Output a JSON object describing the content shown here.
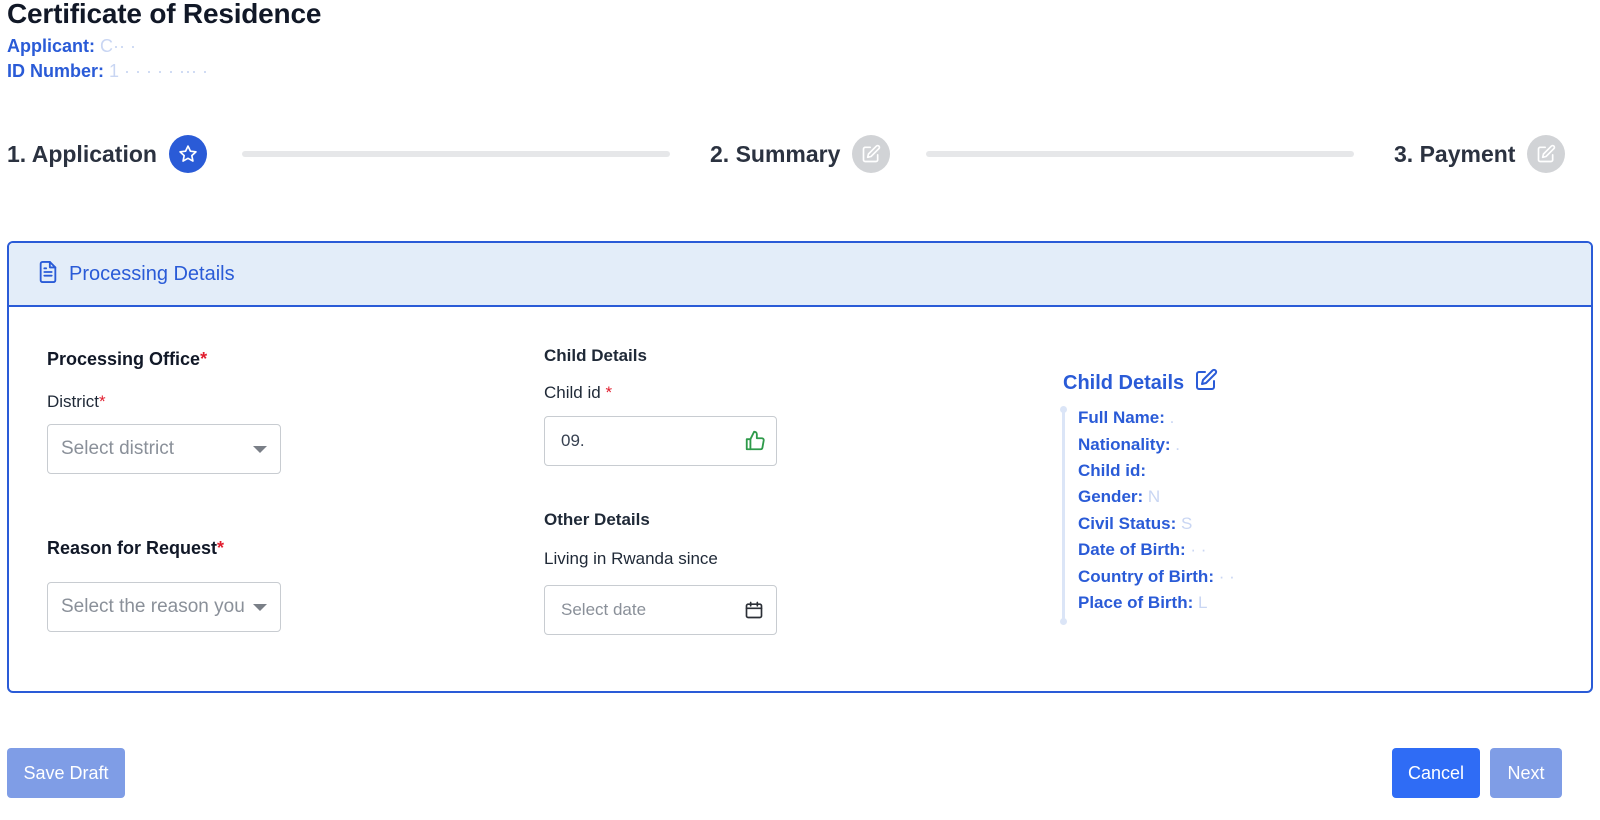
{
  "header": {
    "title": "Certificate of Residence",
    "applicant_label": "Applicant:",
    "applicant_value": "C·· ·",
    "id_label": "ID Number:",
    "id_value": "1 ·  ·  ·  ·  · ··· ·"
  },
  "stepper": {
    "steps": [
      {
        "label": "1. Application",
        "state": "active",
        "icon": "star-icon"
      },
      {
        "label": "2. Summary",
        "state": "inactive",
        "icon": "edit-icon"
      },
      {
        "label": "3. Payment",
        "state": "inactive",
        "icon": "edit-icon"
      }
    ]
  },
  "card": {
    "title": "Processing Details",
    "icon": "document-icon"
  },
  "processing_office": {
    "title": "Processing Office",
    "required_mark": "*",
    "district_label": "District",
    "district_placeholder": "Select district",
    "reason_title": "Reason for Request",
    "reason_placeholder": "Select the reason you"
  },
  "child_form": {
    "title": "Child Details",
    "child_id_label": "Child id",
    "child_id_value": "09.",
    "child_id_status_icon": "thumbs-up-icon",
    "other_title": "Other Details",
    "living_since_label": "Living in Rwanda since",
    "date_placeholder": "Select date"
  },
  "child_details_panel": {
    "title": "Child Details",
    "rows": [
      {
        "label": "Full Name:",
        "value": " ."
      },
      {
        "label": "Nationality:",
        "value": " ."
      },
      {
        "label": "Child id:",
        "value": ""
      },
      {
        "label": "Gender:",
        "value": " N"
      },
      {
        "label": "Civil Status:",
        "value": " S"
      },
      {
        "label": "Date of Birth:",
        "value": " · ·"
      },
      {
        "label": "Country of Birth:",
        "value": " · ·"
      },
      {
        "label": "Place of Birth:",
        "value": " L"
      }
    ]
  },
  "buttons": {
    "save_draft": "Save Draft",
    "cancel": "Cancel",
    "next": "Next"
  },
  "colors": {
    "accent": "#2a5bd7",
    "header_bg": "#e3edf9",
    "required": "#e11d2e",
    "success_icon": "#2e9a4a"
  }
}
